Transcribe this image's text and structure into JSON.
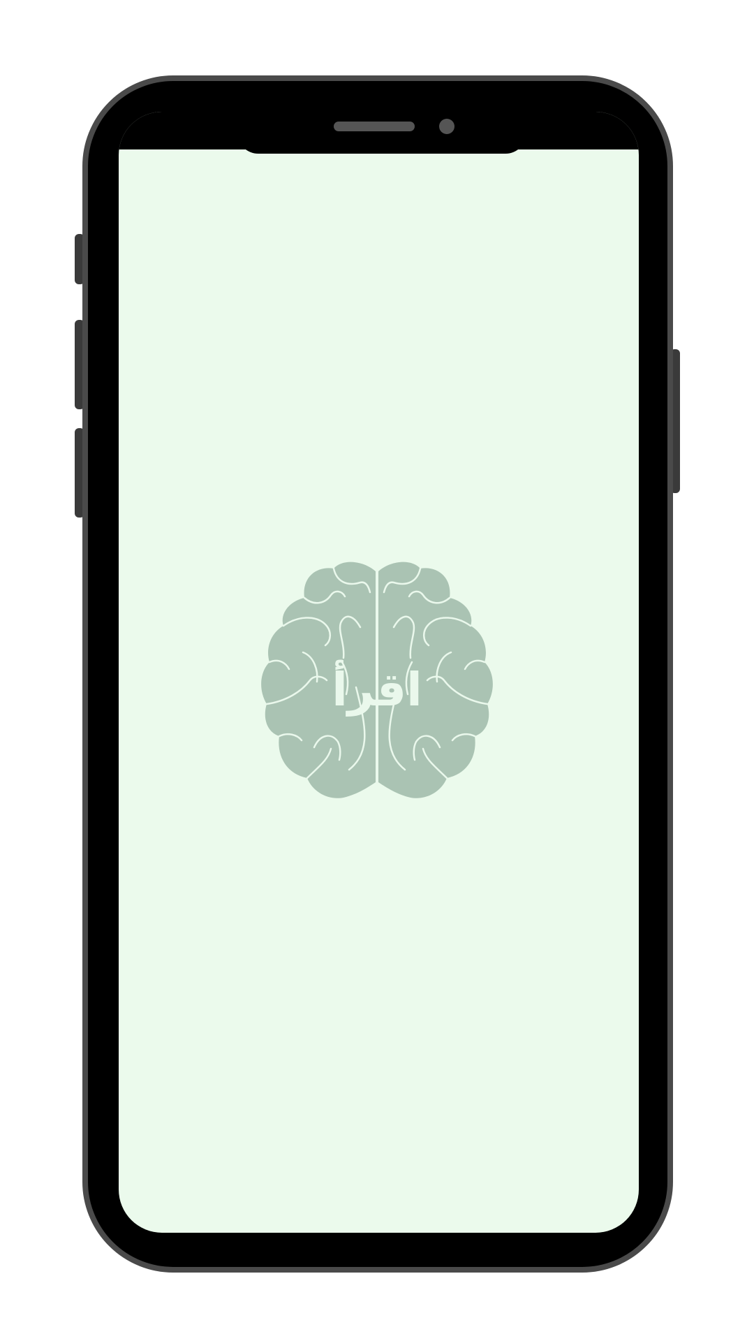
{
  "app": {
    "logo_text": "اقرأ",
    "background_color": "#ebfaec",
    "logo_color": "#aac3b3",
    "logo_line_color": "#eaf8ec"
  },
  "device": {
    "frame_color": "#000000",
    "bezel_color": "#4a4a4a"
  }
}
